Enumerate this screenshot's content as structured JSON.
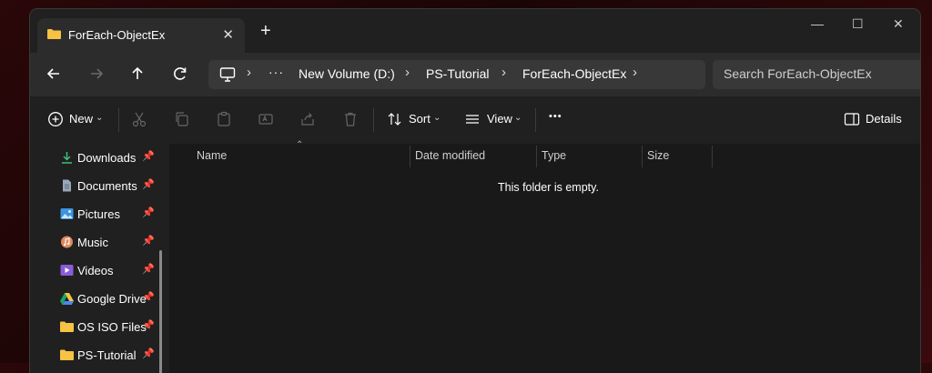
{
  "tab": {
    "title": "ForEach-ObjectEx",
    "close": "✕",
    "new": "+"
  },
  "window_controls": {
    "minimize": "—",
    "maximize": "☐",
    "close": "✕"
  },
  "address": {
    "more": "···",
    "crumbs": [
      "New Volume (D:)",
      "PS-Tutorial",
      "ForEach-ObjectEx"
    ]
  },
  "search": {
    "placeholder": "Search ForEach-ObjectEx"
  },
  "toolbar": {
    "new_label": "New",
    "sort_label": "Sort",
    "view_label": "View",
    "more": "•••",
    "details_label": "Details"
  },
  "sidebar": {
    "items": [
      {
        "label": "Downloads",
        "icon": "download-icon"
      },
      {
        "label": "Documents",
        "icon": "document-icon"
      },
      {
        "label": "Pictures",
        "icon": "pictures-icon"
      },
      {
        "label": "Music",
        "icon": "music-icon"
      },
      {
        "label": "Videos",
        "icon": "videos-icon"
      },
      {
        "label": "Google Drive",
        "icon": "google-drive-icon"
      },
      {
        "label": "OS ISO Files",
        "icon": "folder-icon"
      },
      {
        "label": "PS-Tutorial",
        "icon": "folder-icon"
      }
    ]
  },
  "columns": {
    "name": "Name",
    "date": "Date modified",
    "type": "Type",
    "size": "Size"
  },
  "empty_message": "This folder is empty.",
  "colors": {
    "folder": "#f6c343",
    "accent": "#4cc2ff",
    "window": "#202020"
  }
}
